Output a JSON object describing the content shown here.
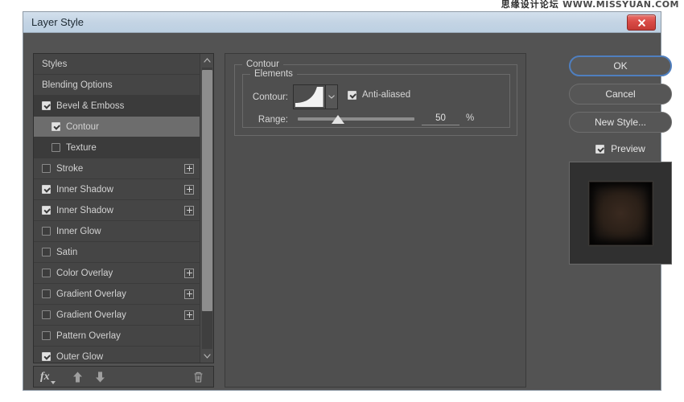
{
  "watermark": {
    "cn": "思缘设计论坛",
    "url": "WWW.MISSYUAN.COM"
  },
  "window": {
    "title": "Layer Style",
    "close_icon": "close-icon"
  },
  "styles_list": {
    "header_label": "Styles",
    "items": [
      {
        "label": "Blending Options",
        "checkbox": "none",
        "selected": false,
        "sub": false,
        "plus": false
      },
      {
        "label": "Bevel & Emboss",
        "checkbox": "checked",
        "selected": "dark",
        "sub": false,
        "plus": false
      },
      {
        "label": "Contour",
        "checkbox": "checked",
        "selected": "light",
        "sub": true,
        "plus": false
      },
      {
        "label": "Texture",
        "checkbox": "unchecked",
        "selected": "dark",
        "sub": true,
        "plus": false
      },
      {
        "label": "Stroke",
        "checkbox": "unchecked",
        "selected": false,
        "sub": false,
        "plus": true
      },
      {
        "label": "Inner Shadow",
        "checkbox": "checked",
        "selected": false,
        "sub": false,
        "plus": true
      },
      {
        "label": "Inner Shadow",
        "checkbox": "checked",
        "selected": false,
        "sub": false,
        "plus": true
      },
      {
        "label": "Inner Glow",
        "checkbox": "unchecked",
        "selected": false,
        "sub": false,
        "plus": false
      },
      {
        "label": "Satin",
        "checkbox": "unchecked",
        "selected": false,
        "sub": false,
        "plus": false
      },
      {
        "label": "Color Overlay",
        "checkbox": "unchecked",
        "selected": false,
        "sub": false,
        "plus": true
      },
      {
        "label": "Gradient Overlay",
        "checkbox": "unchecked",
        "selected": false,
        "sub": false,
        "plus": true
      },
      {
        "label": "Gradient Overlay",
        "checkbox": "unchecked",
        "selected": false,
        "sub": false,
        "plus": true
      },
      {
        "label": "Pattern Overlay",
        "checkbox": "unchecked",
        "selected": false,
        "sub": false,
        "plus": false
      },
      {
        "label": "Outer Glow",
        "checkbox": "checked",
        "selected": false,
        "sub": false,
        "plus": false
      }
    ]
  },
  "toolbar": {
    "fx_label": "fx",
    "fx_icon": "fx-icon",
    "up_icon": "arrow-up-icon",
    "down_icon": "arrow-down-icon",
    "trash_icon": "trash-icon"
  },
  "contour_panel": {
    "group_title": "Contour",
    "elements_title": "Elements",
    "contour_label": "Contour:",
    "contour_swatch_icon": "contour-curve-icon",
    "dropdown_icon": "chevron-down-icon",
    "anti_aliased_label": "Anti-aliased",
    "anti_aliased_checked": true,
    "range_label": "Range:",
    "range_value": "50",
    "range_unit": "%"
  },
  "buttons": {
    "ok": "OK",
    "cancel": "Cancel",
    "new_style": "New Style...",
    "preview_label": "Preview",
    "preview_checked": true
  },
  "colors": {
    "dialog_bg": "#535353",
    "panel_bg": "#4f4f4f",
    "list_bg": "#454545",
    "selected_light": "#6d6d6d",
    "selected_dark": "#3b3b3b",
    "titlebar": "#c4d4e4",
    "accent_focus": "#4f7fbf",
    "close_red": "#d94b46",
    "text": "#d6d6d6"
  }
}
